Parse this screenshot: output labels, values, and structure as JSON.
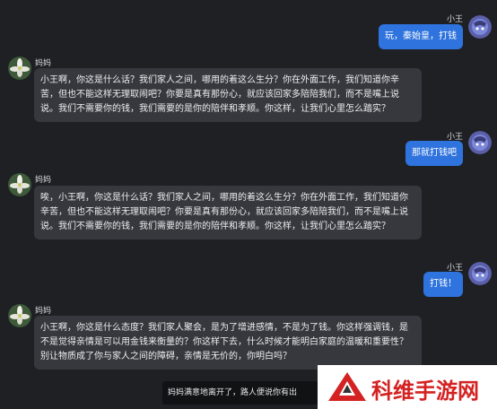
{
  "messages": [
    {
      "sender": "小王",
      "text": "玩，秦始皇，打钱"
    },
    {
      "sender": "妈妈",
      "text": "小王啊，你这是什么话？我们家人之间，哪用的着这么生分？你在外面工作，我们知道你辛苦，但也不能这样无理取闹吧？你要是真有那份心，就应该回家多陪陪我们，而不是嘴上说说。我们不需要你的钱，我们需要的是你的陪伴和孝顺。你这样，让我们心里怎么踏实？"
    },
    {
      "sender": "小王",
      "text": "那就打钱吧"
    },
    {
      "sender": "妈妈",
      "text": "唉，小王啊，你这是什么话？我们家人之间，哪用的着这么生分？你在外面工作，我们知道你辛苦，但也不能这样无理取闹吧？你要是真有那份心，就应该回家多陪陪我们，而不是嘴上说说。我们不需要你的钱，我们需要的是你的陪伴和孝顺。你这样，让我们心里怎么踏实？"
    },
    {
      "sender": "小王",
      "text": "打钱！"
    },
    {
      "sender": "妈妈",
      "text": "小王啊，你这是什么态度？我们家人聚会，是为了增进感情，不是为了钱。你这样强调钱，是不是觉得亲情是可以用金钱来衡量的？你这样下去，什么时候才能明白家庭的温暖和重要性？别让物质成了你与家人之间的障碍，亲情是无价的，你明白吗？"
    }
  ],
  "toast": "妈妈满意地离开了，路人便说你有出",
  "watermark": "科维手游网",
  "colors": {
    "background": "#1f2024",
    "left_bubble": "#36383d",
    "right_bubble": "#2f73de",
    "watermark_red": "#d42222"
  }
}
